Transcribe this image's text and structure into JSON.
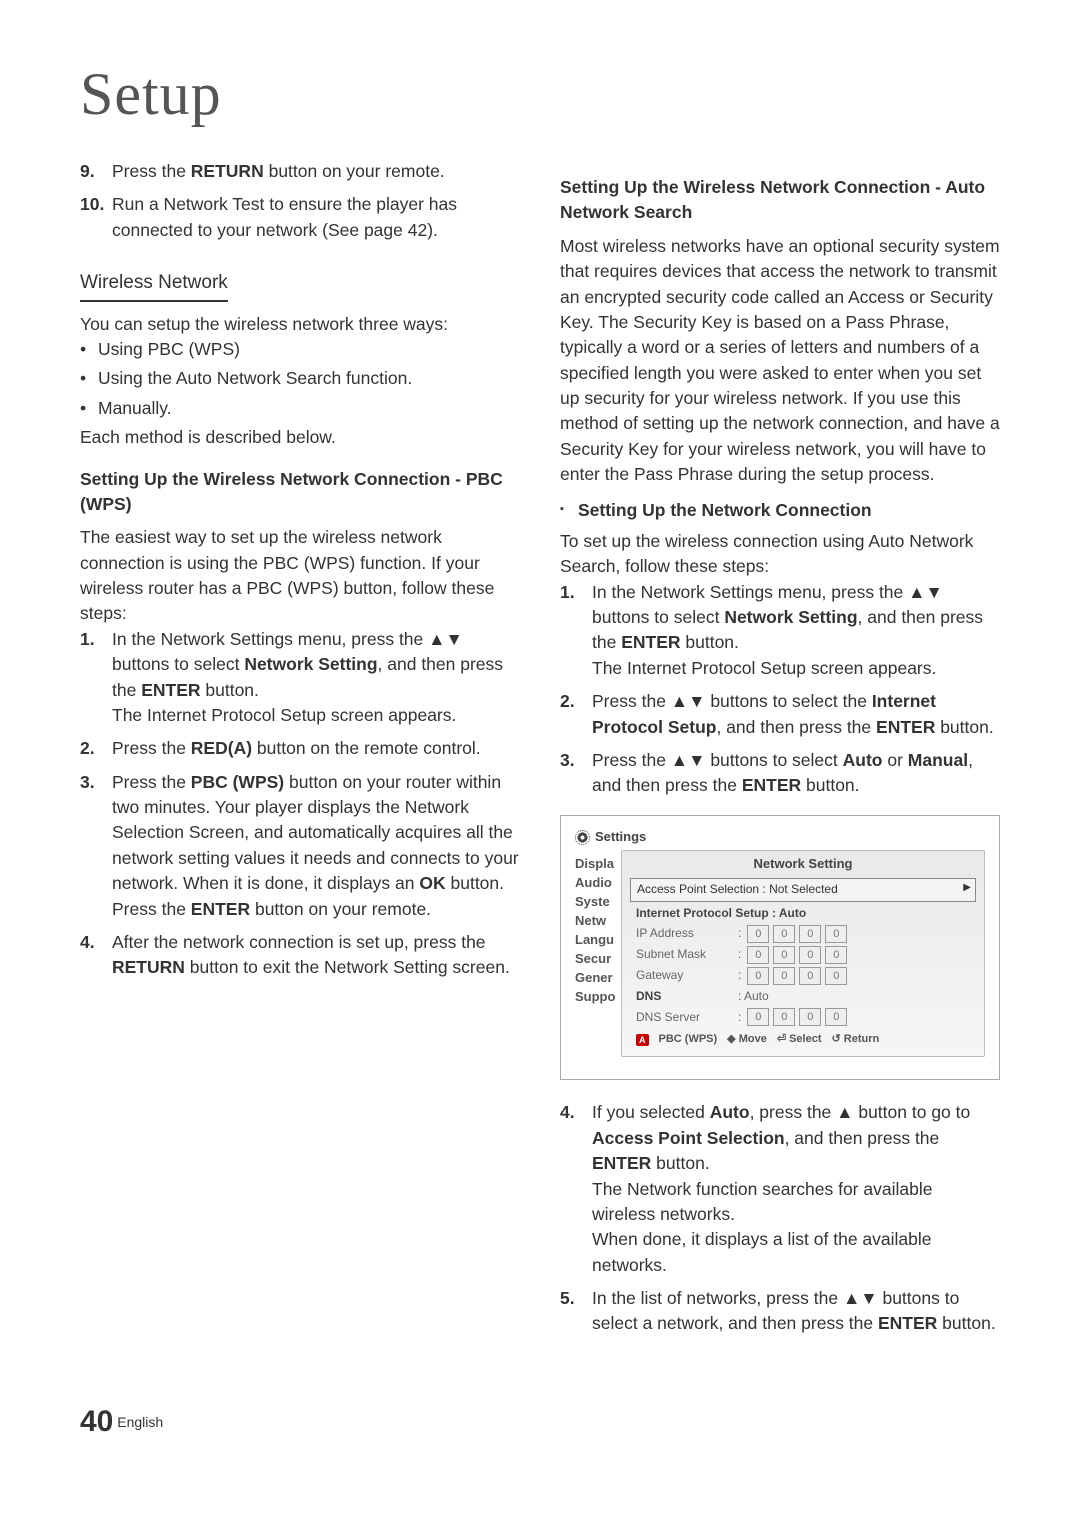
{
  "title": "Setup",
  "left": {
    "steps_top": [
      {
        "n": "9.",
        "parts": [
          "Press the ",
          "RETURN",
          " button on your remote."
        ]
      },
      {
        "n": "10.",
        "parts": [
          "Run a Network Test to ensure the player has connected to your network (See page 42)."
        ]
      }
    ],
    "wireless_h": "Wireless Network",
    "wireless_intro": "You can setup the wireless network three ways:",
    "wireless_bullets": [
      "Using PBC (WPS)",
      "Using the Auto Network Search function.",
      "Manually."
    ],
    "wireless_tail": "Each method is described below.",
    "pbc_h": "Setting Up the Wireless Network Connection - PBC (WPS)",
    "pbc_intro": "The easiest way to set up the wireless network connection is using the PBC (WPS) function. If your wireless router has a PBC (WPS) button, follow these steps:",
    "pbc_steps": [
      {
        "n": "1.",
        "html": "In the Network Settings menu, press the <span class='tri'>▲▼</span> buttons to select <strong>Network Setting</strong>, and then press the <strong>ENTER</strong> button.<br>The Internet Protocol Setup screen appears."
      },
      {
        "n": "2.",
        "html": "Press the <strong>RED(A)</strong> button on the remote control."
      },
      {
        "n": "3.",
        "html": "Press the <strong>PBC (WPS)</strong> button on your router within two minutes. Your player displays the Network Selection Screen, and automatically acquires all the network setting values it needs and connects to your network. When it is done, it displays an <strong>OK</strong> button. Press the <strong>ENTER</strong> button on your remote."
      },
      {
        "n": "4.",
        "html": "After the network connection is set up, press the <strong>RETURN</strong> button to exit the Network Setting screen."
      }
    ]
  },
  "right": {
    "auto_h": "Setting Up the Wireless Network Connection - Auto Network Search",
    "auto_intro": "Most wireless networks have an optional security system that requires devices that access the network to transmit an encrypted security code called an Access or Security Key. The Security Key is based on a Pass Phrase, typically a word or a series of letters and numbers of a specified length you were asked to enter when you set up security for your wireless network. If you use this method of setting up the network connection, and have a Security Key for your wireless network, you will have to enter the Pass Phrase during the setup process.",
    "conn_h": "Setting Up the Network Connection",
    "conn_intro": "To set up the wireless connection using Auto Network Search, follow these steps:",
    "auto_steps_a": [
      {
        "n": "1.",
        "html": "In the Network Settings menu, press the <span class='tri'>▲▼</span> buttons to select <strong>Network Setting</strong>, and then press the <strong>ENTER</strong> button.<br>The Internet Protocol Setup screen appears."
      },
      {
        "n": "2.",
        "html": "Press the <span class='tri'>▲▼</span> buttons to select the <strong>Internet Protocol Setup</strong>, and then press the <strong>ENTER</strong> button."
      },
      {
        "n": "3.",
        "html": "Press the <span class='tri'>▲▼</span> buttons to select <strong>Auto</strong> or <strong>Manual</strong>, and then press the <strong>ENTER</strong> button."
      }
    ],
    "auto_steps_b": [
      {
        "n": "4.",
        "html": "If you selected <strong>Auto</strong>, press the <span class='tri'>▲</span> button to go to <strong>Access Point Selection</strong>, and then press the <strong>ENTER</strong> button.<br>The Network function searches for available wireless networks.<br>When done, it displays a list of the available networks."
      },
      {
        "n": "5.",
        "html": "In the list of networks, press the <span class='tri'>▲▼</span> buttons to select a network, and then press the <strong>ENTER</strong> button."
      }
    ]
  },
  "ui": {
    "settings": "Settings",
    "side": [
      "Displa",
      "Audio",
      "Syste",
      "Netw",
      "Langu",
      "Secur",
      "Gener",
      "Suppo"
    ],
    "panel_title": "Network Setting",
    "aps": "Access Point Selection  : Not Selected",
    "ips_label": "Internet Protocol Setup : Auto",
    "rows": [
      {
        "label": "IP Address",
        "boxes": [
          "0",
          "0",
          "0",
          "0"
        ]
      },
      {
        "label": "Subnet Mask",
        "boxes": [
          "0",
          "0",
          "0",
          "0"
        ]
      },
      {
        "label": "Gateway",
        "boxes": [
          "0",
          "0",
          "0",
          "0"
        ]
      }
    ],
    "dns": "DNS",
    "dns_val": ": Auto",
    "dns_server": {
      "label": "DNS Server",
      "boxes": [
        "0",
        "0",
        "0",
        "0"
      ]
    },
    "footer": {
      "a": "A",
      "pbc": "PBC (WPS)",
      "move": "Move",
      "select": "Select",
      "return": "Return"
    }
  },
  "footer": {
    "page": "40",
    "lang": "English"
  }
}
